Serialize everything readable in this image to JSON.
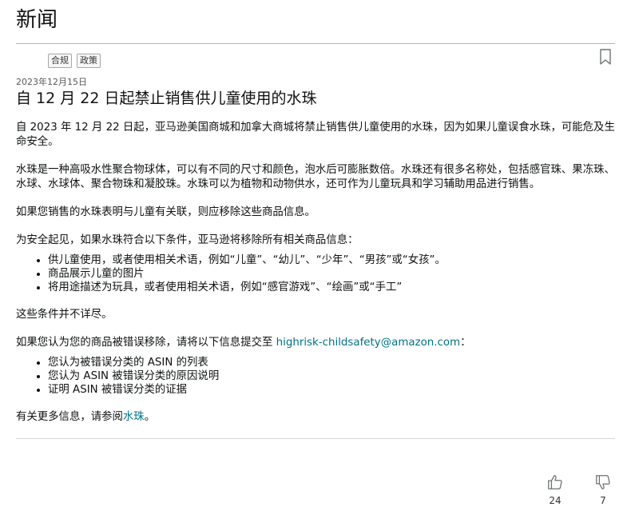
{
  "page": {
    "title": "新闻"
  },
  "tags": [
    "合规",
    "政策"
  ],
  "article": {
    "date": "2023年12月15日",
    "title": "自 12 月 22 日起禁止销售供儿童使用的水珠",
    "para1": "自 2023 年 12 月 22 日起，亚马逊美国商城和加拿大商城将禁止销售供儿童使用的水珠，因为如果儿童误食水珠，可能危及生命安全。",
    "para2": "水珠是一种高吸水性聚合物球体，可以有不同的尺寸和颜色，泡水后可膨胀数倍。水珠还有很多名称处，包括感官珠、果冻珠、水球、水球体、聚合物珠和凝胶珠。水珠可以为植物和动物供水，还可作为儿童玩具和学习辅助用品进行销售。",
    "para3": "如果您销售的水珠表明与儿童有关联，则应移除这些商品信息。",
    "para4": "为安全起见，如果水珠符合以下条件，亚马逊将移除所有相关商品信息：",
    "conditions": [
      "供儿童使用，或者使用相关术语，例如“儿童”、“幼儿”、“少年”、“男孩”或“女孩”。",
      "商品展示儿童的图片",
      "将用途描述为玩具，或者使用相关术语，例如“感官游戏”、“绘画”或“手工”"
    ],
    "para5": "这些条件并不详尽。",
    "para6_prefix": "如果您认为您的商品被错误移除，请将以下信息提交至 ",
    "email": "highrisk-childsafety@amazon.com",
    "para6_suffix": "：",
    "info_items": [
      "您认为被错误分类的 ASIN 的列表",
      "您认为 ASIN 被错误分类的原因说明",
      "证明 ASIN 被错误分类的证据"
    ],
    "more_prefix": "有关更多信息，请参阅",
    "more_link": "水珠",
    "more_suffix": "。"
  },
  "feedback": {
    "likes": "24",
    "dislikes": "7"
  },
  "icons": {
    "bookmark": "bookmark-icon",
    "like": "thumbs-up-icon",
    "dislike": "thumbs-down-icon"
  },
  "colors": {
    "link": "#007185",
    "text": "#0f1111"
  }
}
